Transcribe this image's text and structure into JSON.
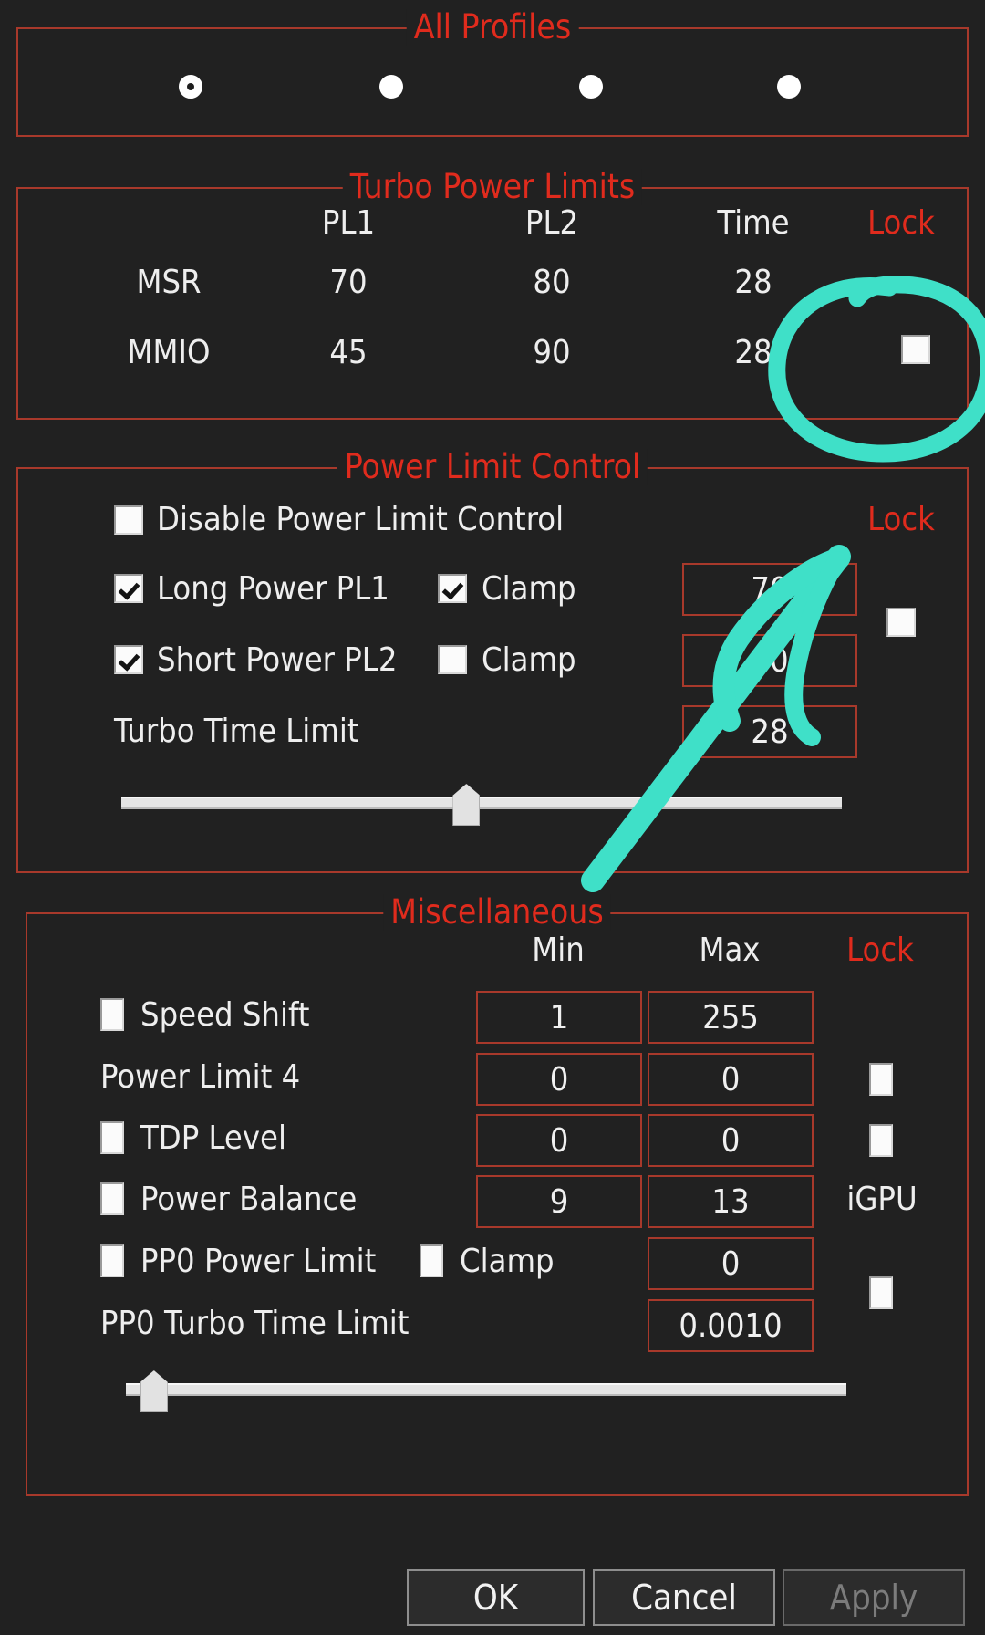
{
  "theme": {
    "background": "#212121",
    "group_border": "#a8392b",
    "legend_color": "#e02b1d",
    "text_color": "#eeeeee",
    "annotation_color": "#3fe0c8"
  },
  "all_profiles": {
    "legend": "All Profiles",
    "radios": [
      {
        "name": "profile-1",
        "selected": true
      },
      {
        "name": "profile-2",
        "selected": false
      },
      {
        "name": "profile-3",
        "selected": false
      },
      {
        "name": "profile-4",
        "selected": false
      }
    ]
  },
  "turbo_power_limits": {
    "legend": "Turbo Power Limits",
    "headers": {
      "pl1": "PL1",
      "pl2": "PL2",
      "time": "Time",
      "lock": "Lock"
    },
    "rows": [
      {
        "label": "MSR",
        "pl1": "70",
        "pl2": "80",
        "time": "28",
        "has_lock": false,
        "lock_checked": false
      },
      {
        "label": "MMIO",
        "pl1": "45",
        "pl2": "90",
        "time": "28",
        "has_lock": true,
        "lock_checked": false
      }
    ]
  },
  "power_limit_control": {
    "legend": "Power Limit Control",
    "lock_header": "Lock",
    "lock_checked": false,
    "disable_row": {
      "label": "Disable Power Limit Control",
      "checked": false
    },
    "long_power_row": {
      "label": "Long Power PL1",
      "checked": true,
      "clamp_label": "Clamp",
      "clamp_checked": true,
      "value": "70"
    },
    "short_power_row": {
      "label": "Short Power PL2",
      "checked": true,
      "clamp_label": "Clamp",
      "clamp_checked": false,
      "value": "80"
    },
    "turbo_time_row": {
      "label": "Turbo Time Limit",
      "value": "28"
    },
    "slider": {
      "name": "turbo-time-slider",
      "position_percent": 46
    }
  },
  "miscellaneous": {
    "legend": "Miscellaneous",
    "headers": {
      "min": "Min",
      "max": "Max",
      "lock": "Lock"
    },
    "rows": [
      {
        "label": "Speed Shift",
        "has_checkbox": true,
        "checked": false,
        "min": "1",
        "max": "255",
        "lock": "none"
      },
      {
        "label": "Power Limit 4",
        "has_checkbox": false,
        "checked": false,
        "min": "0",
        "max": "0",
        "lock": "checkbox",
        "lock_checked": false
      },
      {
        "label": "TDP Level",
        "has_checkbox": true,
        "checked": false,
        "min": "0",
        "max": "0",
        "lock": "checkbox",
        "lock_checked": false
      },
      {
        "label": "Power Balance",
        "has_checkbox": true,
        "checked": false,
        "min": "9",
        "max": "13",
        "lock": "text",
        "lock_text": "iGPU"
      }
    ],
    "pp0_power_limit": {
      "label": "PP0 Power Limit",
      "checked": false,
      "clamp_label": "Clamp",
      "clamp_checked": false,
      "value": "0"
    },
    "pp0_turbo_time": {
      "label": "PP0 Turbo Time Limit",
      "value": "0.0010"
    },
    "pp0_lock_checked": false,
    "slider": {
      "name": "pp0-turbo-time-slider",
      "position_percent": 2
    }
  },
  "buttons": {
    "ok": "OK",
    "cancel": "Cancel",
    "apply": "Apply",
    "apply_disabled": true
  },
  "annotations": [
    {
      "name": "circle-around-mmio-lock-checkbox",
      "shape": "circle"
    },
    {
      "name": "arrow-to-power-limit-control-lock",
      "shape": "arrow"
    }
  ]
}
